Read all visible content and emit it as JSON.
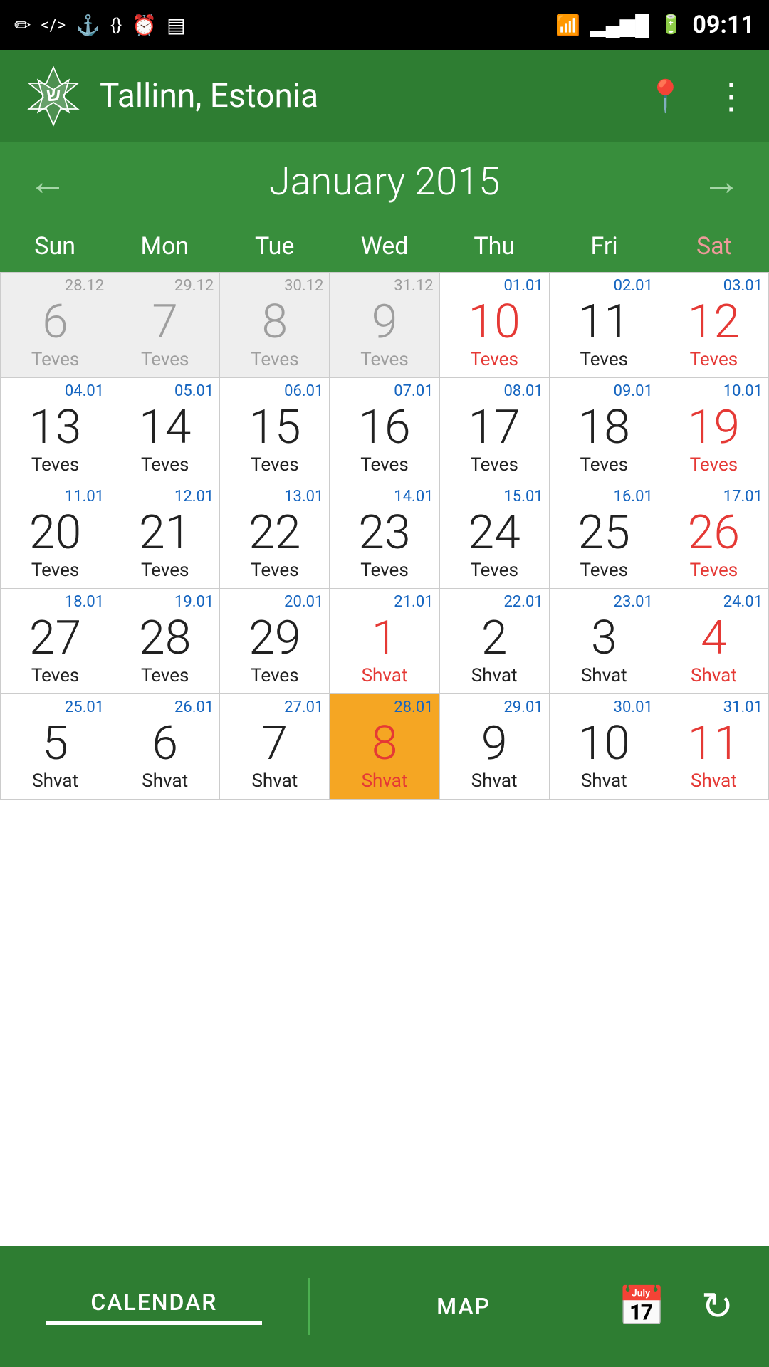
{
  "statusBar": {
    "time": "09:11",
    "icons_left": [
      "pencil-icon",
      "code-icon",
      "usb-icon",
      "code2-icon",
      "clock-icon",
      "barcode-icon"
    ],
    "icons_right": [
      "wifi-icon",
      "signal-icon",
      "battery-icon"
    ]
  },
  "header": {
    "appName": "Tallinn, Estonia",
    "locationIconLabel": "location-icon",
    "moreIconLabel": "more-icon"
  },
  "monthNav": {
    "prevLabel": "←",
    "nextLabel": "→",
    "title": "January 2015"
  },
  "dayHeaders": [
    {
      "label": "Sun",
      "type": "normal"
    },
    {
      "label": "Mon",
      "type": "normal"
    },
    {
      "label": "Tue",
      "type": "normal"
    },
    {
      "label": "Wed",
      "type": "normal"
    },
    {
      "label": "Thu",
      "type": "normal"
    },
    {
      "label": "Fri",
      "type": "normal"
    },
    {
      "label": "Sat",
      "type": "saturday"
    }
  ],
  "calendarRows": [
    {
      "cells": [
        {
          "topDate": "28.12",
          "mainNum": "6",
          "hebrew": "Teves",
          "mainColor": "grey",
          "hebrewColor": "grey",
          "bg": "grey"
        },
        {
          "topDate": "29.12",
          "mainNum": "7",
          "hebrew": "Teves",
          "mainColor": "grey",
          "hebrewColor": "grey",
          "bg": "grey"
        },
        {
          "topDate": "30.12",
          "mainNum": "8",
          "hebrew": "Teves",
          "mainColor": "grey",
          "hebrewColor": "grey",
          "bg": "grey"
        },
        {
          "topDate": "31.12",
          "mainNum": "9",
          "hebrew": "Teves",
          "mainColor": "grey",
          "hebrewColor": "grey",
          "bg": "grey"
        },
        {
          "topDate": "01.01",
          "mainNum": "10",
          "hebrew": "Teves",
          "mainColor": "red",
          "hebrewColor": "red",
          "bg": "normal"
        },
        {
          "topDate": "02.01",
          "mainNum": "11",
          "hebrew": "Teves",
          "mainColor": "normal",
          "hebrewColor": "normal",
          "bg": "normal"
        },
        {
          "topDate": "03.01",
          "mainNum": "12",
          "hebrew": "Teves",
          "mainColor": "red",
          "hebrewColor": "red",
          "bg": "normal"
        }
      ]
    },
    {
      "cells": [
        {
          "topDate": "04.01",
          "mainNum": "13",
          "hebrew": "Teves",
          "mainColor": "normal",
          "hebrewColor": "normal",
          "bg": "normal"
        },
        {
          "topDate": "05.01",
          "mainNum": "14",
          "hebrew": "Teves",
          "mainColor": "normal",
          "hebrewColor": "normal",
          "bg": "normal"
        },
        {
          "topDate": "06.01",
          "mainNum": "15",
          "hebrew": "Teves",
          "mainColor": "normal",
          "hebrewColor": "normal",
          "bg": "normal"
        },
        {
          "topDate": "07.01",
          "mainNum": "16",
          "hebrew": "Teves",
          "mainColor": "normal",
          "hebrewColor": "normal",
          "bg": "normal"
        },
        {
          "topDate": "08.01",
          "mainNum": "17",
          "hebrew": "Teves",
          "mainColor": "normal",
          "hebrewColor": "normal",
          "bg": "normal"
        },
        {
          "topDate": "09.01",
          "mainNum": "18",
          "hebrew": "Teves",
          "mainColor": "normal",
          "hebrewColor": "normal",
          "bg": "normal"
        },
        {
          "topDate": "10.01",
          "mainNum": "19",
          "hebrew": "Teves",
          "mainColor": "red",
          "hebrewColor": "red",
          "bg": "normal"
        }
      ]
    },
    {
      "cells": [
        {
          "topDate": "11.01",
          "mainNum": "20",
          "hebrew": "Teves",
          "mainColor": "normal",
          "hebrewColor": "normal",
          "bg": "normal"
        },
        {
          "topDate": "12.01",
          "mainNum": "21",
          "hebrew": "Teves",
          "mainColor": "normal",
          "hebrewColor": "normal",
          "bg": "normal"
        },
        {
          "topDate": "13.01",
          "mainNum": "22",
          "hebrew": "Teves",
          "mainColor": "normal",
          "hebrewColor": "normal",
          "bg": "normal"
        },
        {
          "topDate": "14.01",
          "mainNum": "23",
          "hebrew": "Teves",
          "mainColor": "normal",
          "hebrewColor": "normal",
          "bg": "normal"
        },
        {
          "topDate": "15.01",
          "mainNum": "24",
          "hebrew": "Teves",
          "mainColor": "normal",
          "hebrewColor": "normal",
          "bg": "normal"
        },
        {
          "topDate": "16.01",
          "mainNum": "25",
          "hebrew": "Teves",
          "mainColor": "normal",
          "hebrewColor": "normal",
          "bg": "normal"
        },
        {
          "topDate": "17.01",
          "mainNum": "26",
          "hebrew": "Teves",
          "mainColor": "red",
          "hebrewColor": "red",
          "bg": "normal"
        }
      ]
    },
    {
      "cells": [
        {
          "topDate": "18.01",
          "mainNum": "27",
          "hebrew": "Teves",
          "mainColor": "normal",
          "hebrewColor": "normal",
          "bg": "normal"
        },
        {
          "topDate": "19.01",
          "mainNum": "28",
          "hebrew": "Teves",
          "mainColor": "normal",
          "hebrewColor": "normal",
          "bg": "normal"
        },
        {
          "topDate": "20.01",
          "mainNum": "29",
          "hebrew": "Teves",
          "mainColor": "normal",
          "hebrewColor": "normal",
          "bg": "normal"
        },
        {
          "topDate": "21.01",
          "mainNum": "1",
          "hebrew": "Shvat",
          "mainColor": "red",
          "hebrewColor": "red",
          "bg": "normal"
        },
        {
          "topDate": "22.01",
          "mainNum": "2",
          "hebrew": "Shvat",
          "mainColor": "normal",
          "hebrewColor": "normal",
          "bg": "normal"
        },
        {
          "topDate": "23.01",
          "mainNum": "3",
          "hebrew": "Shvat",
          "mainColor": "normal",
          "hebrewColor": "normal",
          "bg": "normal"
        },
        {
          "topDate": "24.01",
          "mainNum": "4",
          "hebrew": "Shvat",
          "mainColor": "red",
          "hebrewColor": "red",
          "bg": "normal"
        }
      ]
    },
    {
      "cells": [
        {
          "topDate": "25.01",
          "mainNum": "5",
          "hebrew": "Shvat",
          "mainColor": "normal",
          "hebrewColor": "normal",
          "bg": "normal"
        },
        {
          "topDate": "26.01",
          "mainNum": "6",
          "hebrew": "Shvat",
          "mainColor": "normal",
          "hebrewColor": "normal",
          "bg": "normal"
        },
        {
          "topDate": "27.01",
          "mainNum": "7",
          "hebrew": "Shvat",
          "mainColor": "normal",
          "hebrewColor": "normal",
          "bg": "normal"
        },
        {
          "topDate": "28.01",
          "mainNum": "8",
          "hebrew": "Shvat",
          "mainColor": "red",
          "hebrewColor": "red",
          "bg": "today"
        },
        {
          "topDate": "29.01",
          "mainNum": "9",
          "hebrew": "Shvat",
          "mainColor": "normal",
          "hebrewColor": "normal",
          "bg": "normal"
        },
        {
          "topDate": "30.01",
          "mainNum": "10",
          "hebrew": "Shvat",
          "mainColor": "normal",
          "hebrewColor": "normal",
          "bg": "normal"
        },
        {
          "topDate": "31.01",
          "mainNum": "11",
          "hebrew": "Shvat",
          "mainColor": "red",
          "hebrewColor": "red",
          "bg": "normal"
        }
      ]
    }
  ],
  "bottomNav": {
    "calendarLabel": "CALENDAR",
    "mapLabel": "MAP",
    "calendarIconLabel": "calendar-icon",
    "refreshIconLabel": "refresh-icon"
  }
}
